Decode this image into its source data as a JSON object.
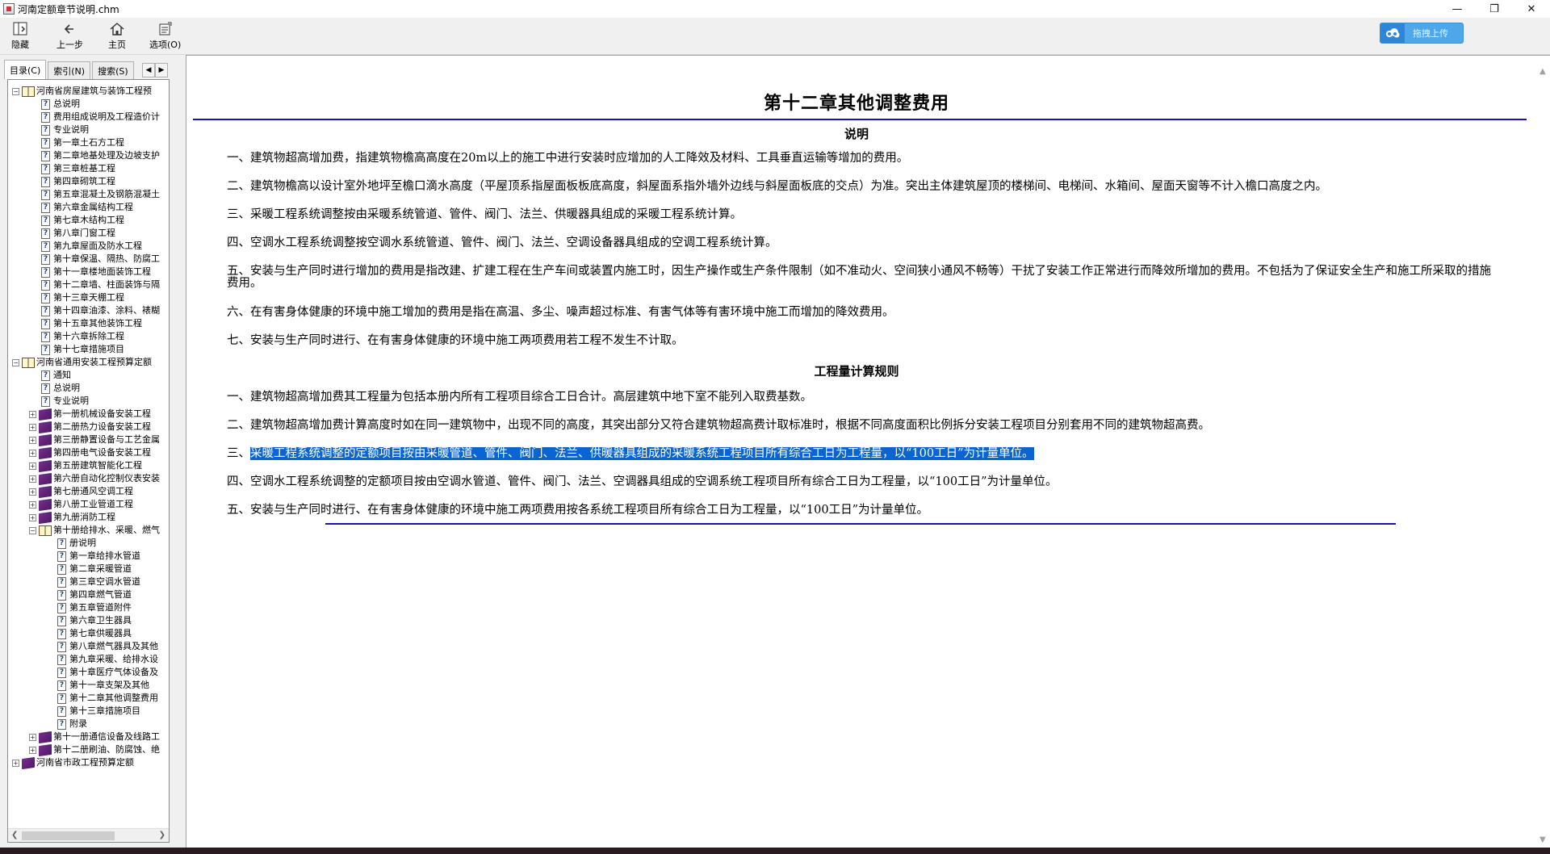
{
  "window": {
    "title": "河南定额章节说明.chm"
  },
  "toolbar": {
    "hide": "隐藏",
    "back": "上一步",
    "home": "主页",
    "options": "选项(O)",
    "upload": "拖拽上传"
  },
  "nav": {
    "tabs": [
      "目录(C)",
      "索引(N)",
      "搜索(S)"
    ],
    "tree": [
      {
        "level": 0,
        "type": "open",
        "exp": "−",
        "label": "河南省房屋建筑与装饰工程预"
      },
      {
        "level": 1,
        "type": "page",
        "label": "总说明"
      },
      {
        "level": 1,
        "type": "page",
        "label": "费用组成说明及工程造价计"
      },
      {
        "level": 1,
        "type": "page",
        "label": "专业说明"
      },
      {
        "level": 1,
        "type": "page",
        "label": "第一章土石方工程"
      },
      {
        "level": 1,
        "type": "page",
        "label": "第二章地基处理及边坡支护"
      },
      {
        "level": 1,
        "type": "page",
        "label": "第三章桩基工程"
      },
      {
        "level": 1,
        "type": "page",
        "label": "第四章砌筑工程"
      },
      {
        "level": 1,
        "type": "page",
        "label": "第五章混凝土及钢筋混凝土"
      },
      {
        "level": 1,
        "type": "page",
        "label": "第六章金属结构工程"
      },
      {
        "level": 1,
        "type": "page",
        "label": "第七章木结构工程"
      },
      {
        "level": 1,
        "type": "page",
        "label": "第八章门窗工程"
      },
      {
        "level": 1,
        "type": "page",
        "label": "第九章屋面及防水工程"
      },
      {
        "level": 1,
        "type": "page",
        "label": "第十章保温、隔热、防腐工"
      },
      {
        "level": 1,
        "type": "page",
        "label": "第十一章楼地面装饰工程"
      },
      {
        "level": 1,
        "type": "page",
        "label": "第十二章墙、柱面装饰与隔"
      },
      {
        "level": 1,
        "type": "page",
        "label": "第十三章天棚工程"
      },
      {
        "level": 1,
        "type": "page",
        "label": "第十四章油漆、涂料、裱糊"
      },
      {
        "level": 1,
        "type": "page",
        "label": "第十五章其他装饰工程"
      },
      {
        "level": 1,
        "type": "page",
        "label": "第十六章拆除工程"
      },
      {
        "level": 1,
        "type": "page",
        "label": "第十七章措施项目"
      },
      {
        "level": 0,
        "type": "open",
        "exp": "−",
        "label": "河南省通用安装工程预算定额"
      },
      {
        "level": 1,
        "type": "page",
        "label": "通知"
      },
      {
        "level": 1,
        "type": "page",
        "label": "总说明"
      },
      {
        "level": 1,
        "type": "page",
        "label": "专业说明"
      },
      {
        "level": 1,
        "type": "closed",
        "exp": "+",
        "label": "第一册机械设备安装工程"
      },
      {
        "level": 1,
        "type": "closed",
        "exp": "+",
        "label": "第二册热力设备安装工程"
      },
      {
        "level": 1,
        "type": "closed",
        "exp": "+",
        "label": "第三册静置设备与工艺金属"
      },
      {
        "level": 1,
        "type": "closed",
        "exp": "+",
        "label": "第四册电气设备安装工程"
      },
      {
        "level": 1,
        "type": "closed",
        "exp": "+",
        "label": "第五册建筑智能化工程"
      },
      {
        "level": 1,
        "type": "closed",
        "exp": "+",
        "label": "第六册自动化控制仪表安装"
      },
      {
        "level": 1,
        "type": "closed",
        "exp": "+",
        "label": "第七册通风空调工程"
      },
      {
        "level": 1,
        "type": "closed",
        "exp": "+",
        "label": "第八册工业管道工程"
      },
      {
        "level": 1,
        "type": "closed",
        "exp": "+",
        "label": "第九册消防工程"
      },
      {
        "level": 1,
        "type": "open",
        "exp": "−",
        "label": "第十册给排水、采暖、燃气"
      },
      {
        "level": 2,
        "type": "page",
        "label": "册说明"
      },
      {
        "level": 2,
        "type": "page",
        "label": "第一章给排水管道"
      },
      {
        "level": 2,
        "type": "page",
        "label": "第二章采暖管道"
      },
      {
        "level": 2,
        "type": "page",
        "label": "第三章空调水管道"
      },
      {
        "level": 2,
        "type": "page",
        "label": "第四章燃气管道"
      },
      {
        "level": 2,
        "type": "page",
        "label": "第五章管道附件"
      },
      {
        "level": 2,
        "type": "page",
        "label": "第六章卫生器具"
      },
      {
        "level": 2,
        "type": "page",
        "label": "第七章供暖器具"
      },
      {
        "level": 2,
        "type": "page",
        "label": "第八章燃气器具及其他"
      },
      {
        "level": 2,
        "type": "page",
        "label": "第九章采暖、给排水设"
      },
      {
        "level": 2,
        "type": "page",
        "label": "第十章医疗气体设备及"
      },
      {
        "level": 2,
        "type": "page",
        "label": "第十一章支架及其他"
      },
      {
        "level": 2,
        "type": "page",
        "label": "第十二章其他调整费用"
      },
      {
        "level": 2,
        "type": "page",
        "label": "第十三章措施项目"
      },
      {
        "level": 2,
        "type": "page",
        "label": "附录"
      },
      {
        "level": 1,
        "type": "closed",
        "exp": "+",
        "label": "第十一册通信设备及线路工"
      },
      {
        "level": 1,
        "type": "closed",
        "exp": "+",
        "label": "第十二册刷油、防腐蚀、绝"
      },
      {
        "level": 0,
        "type": "closed",
        "exp": "+",
        "label": "河南省市政工程预算定额"
      }
    ]
  },
  "doc": {
    "title": "第十二章其他调整费用",
    "section1": "说明",
    "paras1": [
      "一、建筑物超高增加费，指建筑物檐高高度在20m以上的施工中进行安装时应增加的人工降效及材料、工具垂直运输等增加的费用。",
      "二、建筑物檐高以设计室外地坪至檐口滴水高度（平屋顶系指屋面板板底高度，斜屋面系指外墙外边线与斜屋面板底的交点）为准。突出主体建筑屋顶的楼梯间、电梯间、水箱间、屋面天窗等不计入檐口高度之内。",
      "三、采暖工程系统调整按由采暖系统管道、管件、阀门、法兰、供暖器具组成的采暖工程系统计算。",
      "四、空调水工程系统调整按空调水系统管道、管件、阀门、法兰、空调设备器具组成的空调工程系统计算。",
      "五、安装与生产同时进行增加的费用是指改建、扩建工程在生产车间或装置内施工时，因生产操作或生产条件限制（如不准动火、空间狭小通风不畅等）干扰了安装工作正常进行而降效所增加的费用。不包括为了保证安全生产和施工所采取的措施费用。",
      "六、在有害身体健康的环境中施工增加的费用是指在高温、多尘、噪声超过标准、有害气体等有害环境中施工而增加的降效费用。",
      "七、安装与生产同时进行、在有害身体健康的环境中施工两项费用若工程不发生不计取。"
    ],
    "section2": "工程量计算规则",
    "paras2": [
      "一、建筑物超高增加费其工程量为包括本册内所有工程项目综合工日合计。高层建筑中地下室不能列入取费基数。",
      "二、建筑物超高增加费计算高度时如在同一建筑物中，出现不同的高度，其突出部分又符合建筑物超高费计取标准时，根据不同高度面积比例拆分安装工程项目分别套用不同的建筑物超高费。",
      "四、空调水工程系统调整的定额项目按由空调水管道、管件、阀门、法兰、空调器具组成的空调系统工程项目所有综合工日为工程量，以“100工日”为计量单位。",
      "五、安装与生产同时进行、在有害身体健康的环境中施工两项费用按各系统工程项目所有综合工日为工程量，以“100工日”为计量单位。"
    ],
    "para3_prefix": "三、",
    "para3_highlight": "采暖工程系统调整的定额项目按由采暖管道、管件、阀门、法兰、供暖器具组成的采暖系统工程项目所有综合工日为工程量，以“100工日”为计量单位。"
  },
  "colors": {
    "rule": "#1414b4",
    "highlight": "#0a64d2",
    "upload": "#4ea7ea"
  }
}
